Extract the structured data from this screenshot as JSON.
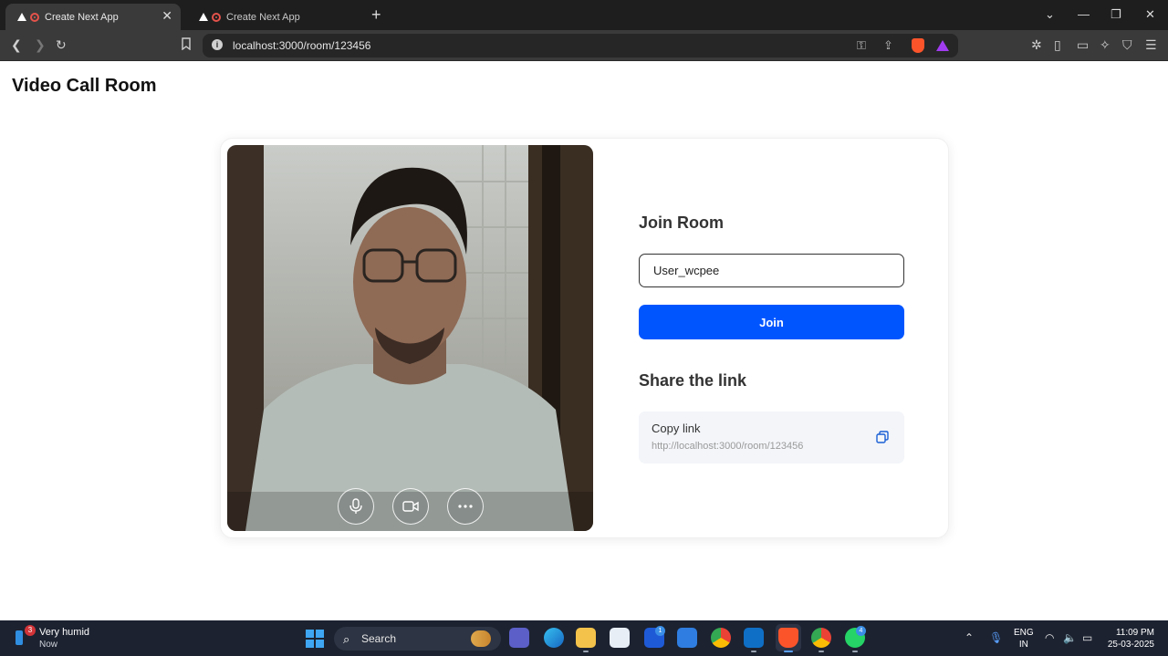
{
  "browser": {
    "tabs": [
      {
        "title": "Create Next App",
        "active": true
      },
      {
        "title": "Create Next App",
        "active": false
      }
    ],
    "url": "localhost:3000/room/123456"
  },
  "page": {
    "title": "Video Call Room",
    "join": {
      "heading": "Join Room",
      "name_value": "User_wcpee",
      "button_label": "Join"
    },
    "share": {
      "heading": "Share the link",
      "copy_label": "Copy link",
      "link": "http://localhost:3000/room/123456"
    },
    "video_controls": [
      "microphone",
      "camera",
      "more"
    ]
  },
  "taskbar": {
    "weather_badge": "3",
    "weather_title": "Very humid",
    "weather_sub": "Now",
    "search_label": "Search",
    "lang_top": "ENG",
    "lang_bottom": "IN",
    "time": "11:09 PM",
    "date": "25-03-2025",
    "badges": {
      "teams_l": "1",
      "whatsapp": "4"
    }
  },
  "colors": {
    "primary": "#0055ff",
    "chrome_dark": "#1e1e1e",
    "taskbar": "#1c2230"
  }
}
